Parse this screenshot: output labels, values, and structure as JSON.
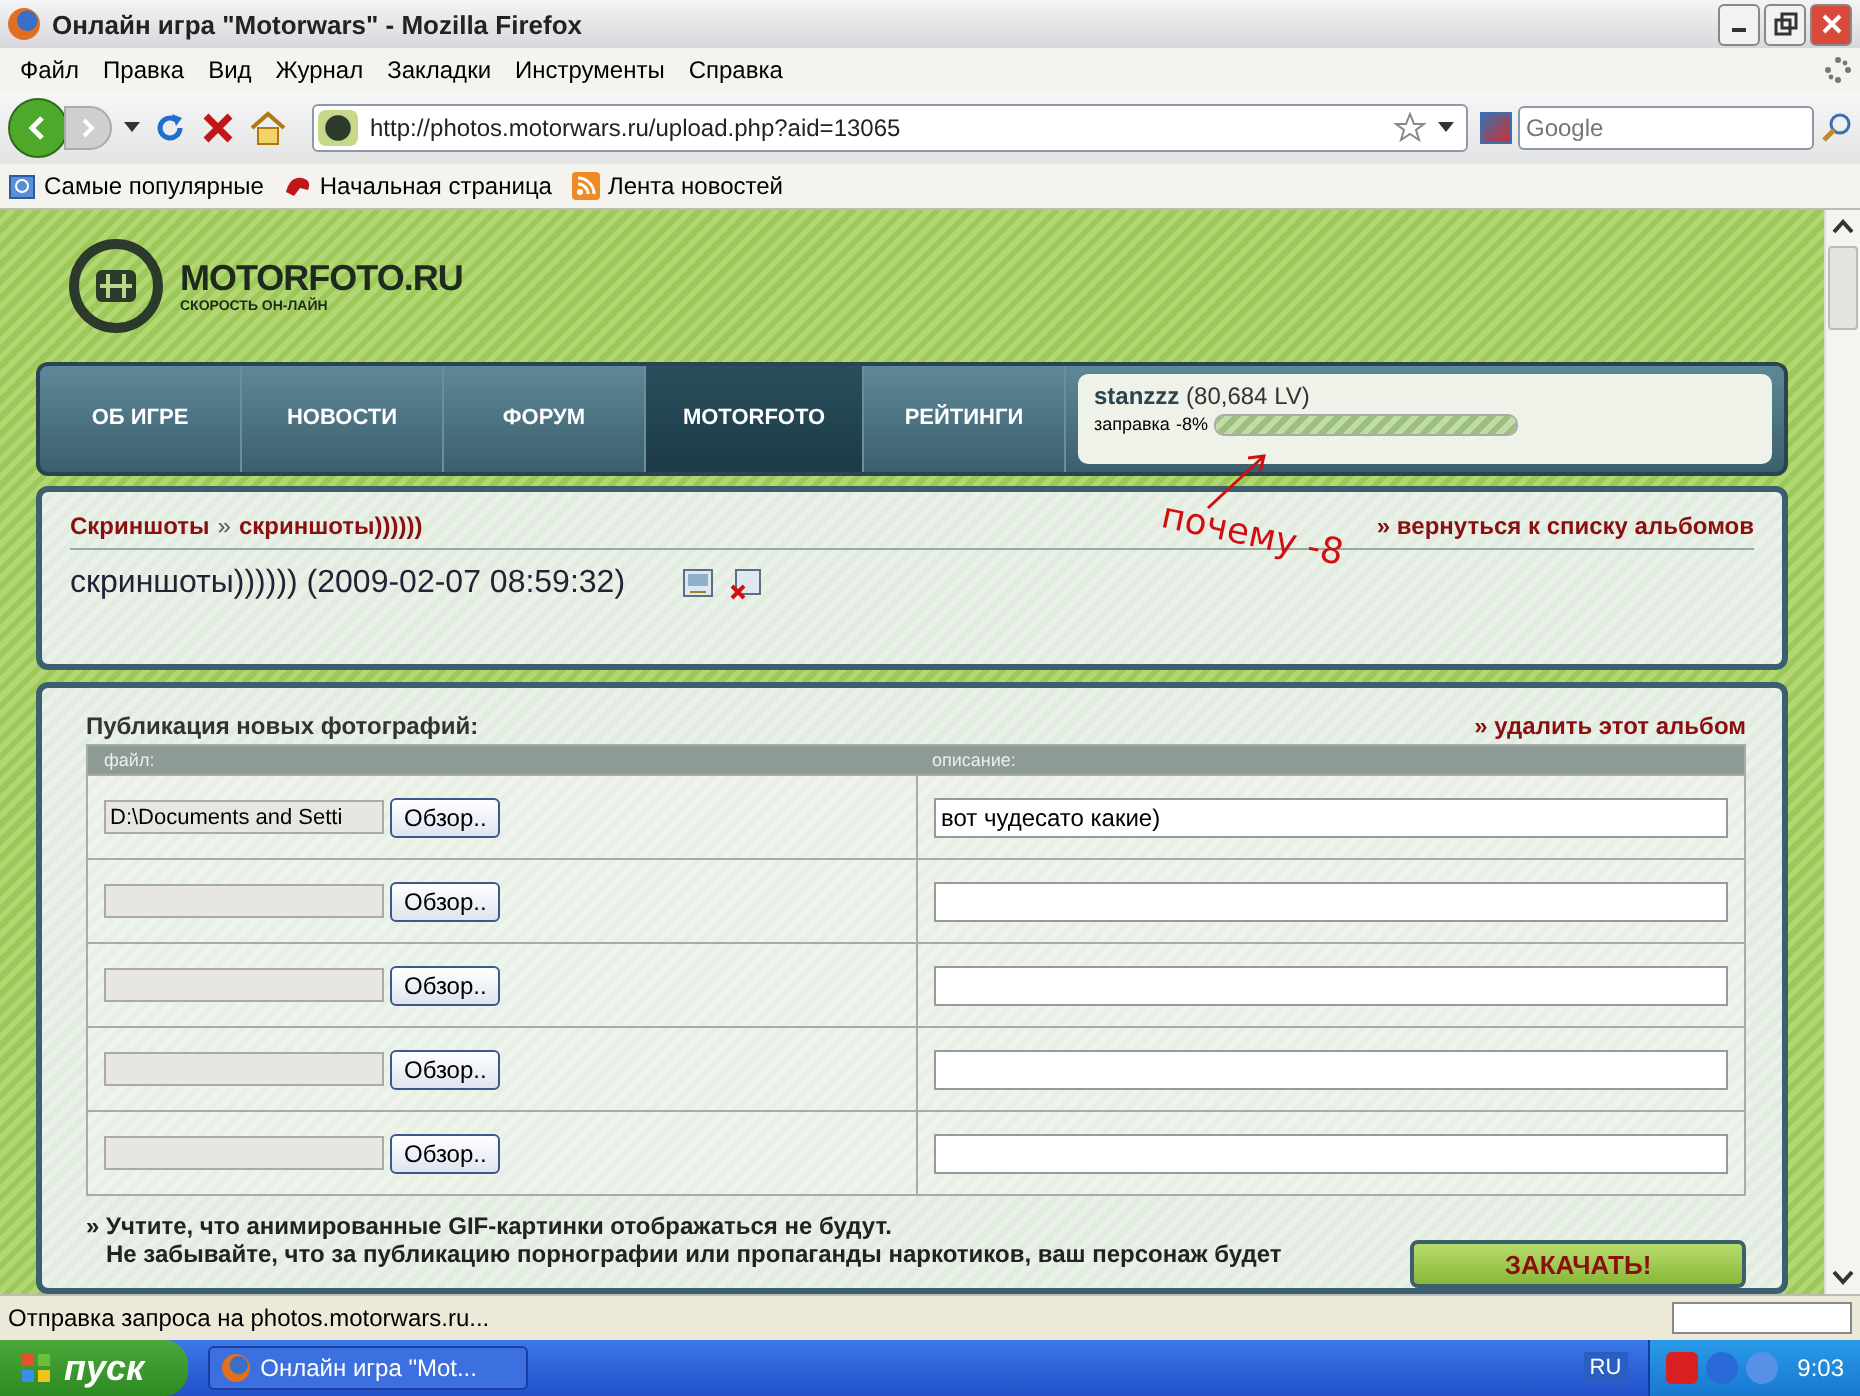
{
  "window": {
    "title": "Онлайн игра \"Motorwars\" - Mozilla Firefox"
  },
  "menu": [
    "Файл",
    "Правка",
    "Вид",
    "Журнал",
    "Закладки",
    "Инструменты",
    "Справка"
  ],
  "toolbar": {
    "url": "http://photos.motorwars.ru/upload.php?aid=13065",
    "search_placeholder": "Google"
  },
  "bookmarks": [
    {
      "label": "Самые популярные",
      "kind": "folder"
    },
    {
      "label": "Начальная страница",
      "kind": "site"
    },
    {
      "label": "Лента новостей",
      "kind": "rss"
    }
  ],
  "site": {
    "logo": "MOTORFOTO.RU",
    "tagline": "СКОРОСТЬ ОН-ЛАЙН",
    "nav": [
      {
        "label": "ОБ ИГРЕ",
        "selected": false
      },
      {
        "label": "НОВОСТИ",
        "selected": false
      },
      {
        "label": "ФОРУМ",
        "selected": false
      },
      {
        "label": "MOTORFOTO",
        "selected": true
      },
      {
        "label": "РЕЙТИНГИ",
        "selected": false
      }
    ],
    "user": {
      "name": "stanzzz",
      "lv": "(80,684 LV)",
      "fuel_label": "заправка",
      "fuel_reading": "-8%",
      "level": 1
    }
  },
  "album": {
    "breadcrumb": [
      "Скриншоты",
      "»",
      "скриншоты))))))"
    ],
    "back_link": "» вернуться к списку альбомов",
    "title": "скриншоты)))))) (2009-02-07 08:59:32)"
  },
  "upload": {
    "heading": "Публикация новых фотографий:",
    "delete_link": "» удалить этот альбом",
    "columns": [
      "файл:",
      "описание:"
    ],
    "rows": [
      {
        "file": "D:\\Documents and Setti",
        "browse": "Обзор..",
        "description": "вот чудесато какие)"
      },
      {
        "file": "",
        "browse": "Обзор..",
        "description": ""
      },
      {
        "file": "",
        "browse": "Обзор..",
        "description": ""
      },
      {
        "file": "",
        "browse": "Обзор..",
        "description": ""
      },
      {
        "file": "",
        "browse": "Обзор..",
        "description": ""
      }
    ],
    "notes": [
      "» Учтите, что анимированные GIF-картинки отображаться не будут.",
      "Не забывайте, что за публикацию порнографии или пропаганды наркотиков, ваш персонаж будет"
    ],
    "submit": "ЗАКАЧАТЬ!"
  },
  "annotation": "почему -8",
  "status_bar": "Отправка запроса на photos.motorwars.ru...",
  "taskbar": {
    "start": "пуск",
    "task": "Онлайн игра \"Mot...",
    "lang": "RU",
    "clock": "9:03"
  }
}
